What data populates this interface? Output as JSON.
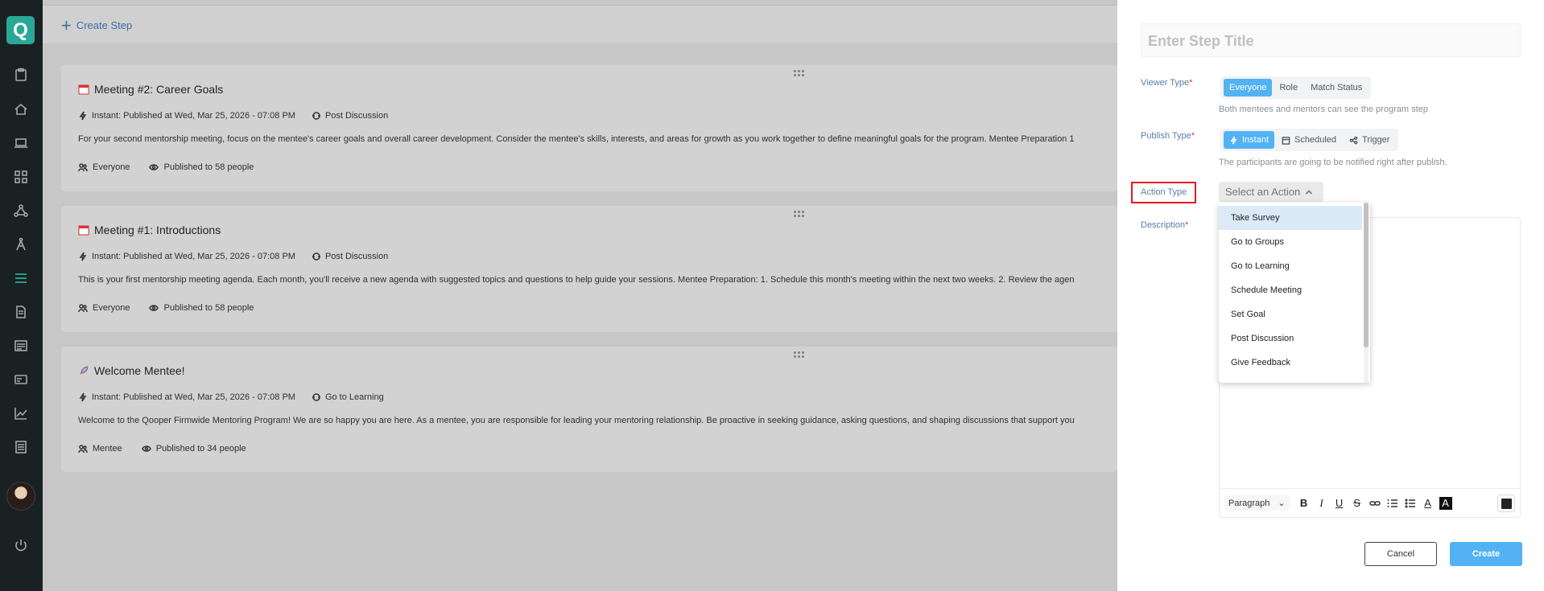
{
  "app": {
    "logo_letter": "Q"
  },
  "sidebar": {
    "items": [
      {
        "name": "sidebar-item-dashboard",
        "icon": "clipboard-icon"
      },
      {
        "name": "sidebar-item-home",
        "icon": "home-icon"
      },
      {
        "name": "sidebar-item-learning",
        "icon": "laptop-icon"
      },
      {
        "name": "sidebar-item-apps",
        "icon": "grid-icon"
      },
      {
        "name": "sidebar-item-network",
        "icon": "network-icon"
      },
      {
        "name": "sidebar-item-mentoring",
        "icon": "compass-icon"
      },
      {
        "name": "sidebar-item-program-steps",
        "icon": "list-icon",
        "active": true
      },
      {
        "name": "sidebar-item-documents",
        "icon": "document-icon"
      },
      {
        "name": "sidebar-item-news",
        "icon": "news-icon"
      },
      {
        "name": "sidebar-item-cards",
        "icon": "card-icon"
      },
      {
        "name": "sidebar-item-analytics",
        "icon": "chart-icon"
      },
      {
        "name": "sidebar-item-reports",
        "icon": "report-icon"
      }
    ],
    "power_icon": "power-icon"
  },
  "main": {
    "create_step_label": "Create Step",
    "cards": [
      {
        "title": "Meeting #2: Career Goals",
        "publish": "Instant: Published at Wed, Mar 25, 2026 - 07:08 PM",
        "action": "Post Discussion",
        "description": "For your second mentorship meeting, focus on the mentee's career goals and overall career development. Consider the mentee's skills, interests, and areas for growth as you work together to define meaningful goals for the program. Mentee Preparation 1",
        "audience": "Everyone",
        "published_to": "Published to 58 people"
      },
      {
        "title": "Meeting #1: Introductions",
        "publish": "Instant: Published at Wed, Mar 25, 2026 - 07:08 PM",
        "action": "Post Discussion",
        "description": "This is your first mentorship meeting agenda. Each month, you'll receive a new agenda with suggested topics and questions to help guide your sessions. Mentee Preparation: 1. Schedule this month's meeting within the next two weeks. 2. Review the agen",
        "audience": "Everyone",
        "published_to": "Published to 58 people"
      },
      {
        "title": "Welcome Mentee!",
        "publish": "Instant: Published at Wed, Mar 25, 2026 - 07:08 PM",
        "action": "Go to Learning",
        "description": "Welcome to the Qooper Firmwide Mentoring Program! We are so happy you are here. As a mentee, you are responsible for leading your mentoring relationship. Be proactive in seeking guidance, asking questions, and shaping discussions that support you",
        "audience": "Mentee",
        "published_to": "Published to 34 people"
      }
    ]
  },
  "panel": {
    "title_placeholder": "Enter Step Title",
    "viewer_type": {
      "label": "Viewer Type",
      "options": [
        "Everyone",
        "Role",
        "Match Status"
      ],
      "selected": "Everyone",
      "helper": "Both mentees and mentors can see the program step"
    },
    "publish_type": {
      "label": "Publish Type",
      "options": [
        "Instant",
        "Scheduled",
        "Trigger"
      ],
      "selected": "Instant",
      "helper": "The participants are going to be notified right after publish."
    },
    "action_type": {
      "label": "Action Type",
      "placeholder": "Select an Action",
      "options": [
        "Take Survey",
        "Go to Groups",
        "Go to Learning",
        "Schedule Meeting",
        "Set Goal",
        "Post Discussion",
        "Give Feedback"
      ],
      "hovered": "Take Survey"
    },
    "description": {
      "label": "Description",
      "paragraph_style": "Paragraph"
    },
    "cancel_label": "Cancel",
    "create_label": "Create"
  },
  "colors": {
    "accent": "#52b2f4",
    "sidebar_bg": "#1a2123",
    "logo_bg": "#2aa897",
    "required": "#e0413d",
    "highlight_box": "#e31b23"
  }
}
